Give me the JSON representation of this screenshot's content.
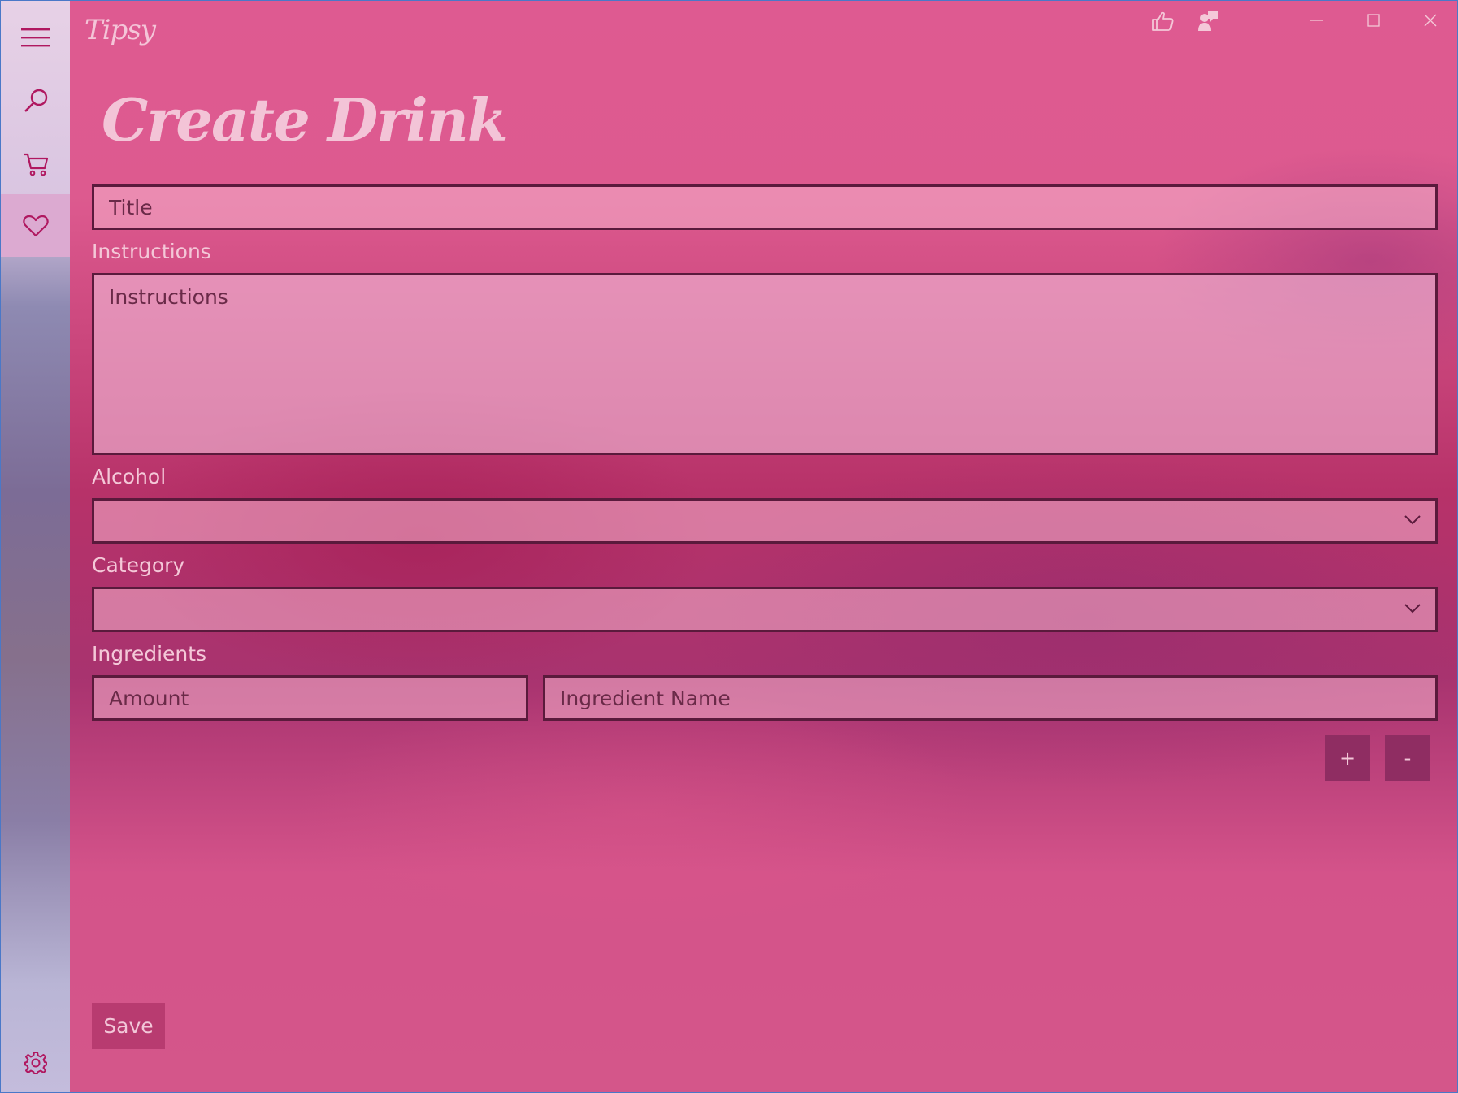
{
  "app": {
    "title": "Tipsy"
  },
  "sidebar": {
    "items": [
      {
        "name": "menu",
        "icon": "hamburger-icon"
      },
      {
        "name": "search",
        "icon": "search-icon"
      },
      {
        "name": "cart",
        "icon": "cart-icon"
      },
      {
        "name": "favorites",
        "icon": "heart-icon",
        "selected": true
      },
      {
        "name": "settings",
        "icon": "gear-icon"
      }
    ]
  },
  "titlebar": {
    "icons": [
      "thumbs-up-icon",
      "feedback-icon",
      "minimize-icon",
      "maximize-icon",
      "close-icon"
    ]
  },
  "page": {
    "title": "Create Drink"
  },
  "form": {
    "title_placeholder": "Title",
    "instructions_label": "Instructions",
    "instructions_placeholder": "Instructions",
    "alcohol_label": "Alcohol",
    "alcohol_value": "",
    "category_label": "Category",
    "category_value": "",
    "ingredients_label": "Ingredients",
    "amount_placeholder": "Amount",
    "ingredient_name_placeholder": "Ingredient Name",
    "add_label": "+",
    "remove_label": "-",
    "save_label": "Save"
  },
  "colors": {
    "accent": "#d6558a",
    "sidebar_selected": "#dcaad1",
    "field_border": "#5a1a3c",
    "button": "#8f2d62"
  }
}
